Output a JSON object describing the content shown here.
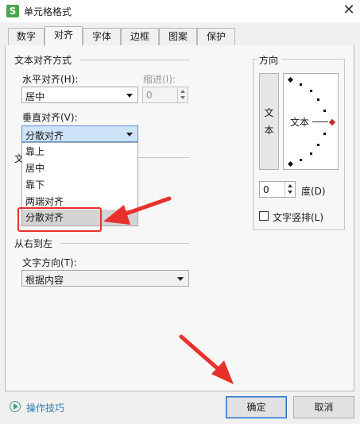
{
  "window": {
    "app_logo": "S",
    "title": "单元格格式",
    "close_glyph": "✕"
  },
  "tabs": [
    {
      "label": "数字",
      "active": false
    },
    {
      "label": "对齐",
      "active": true
    },
    {
      "label": "字体",
      "active": false
    },
    {
      "label": "边框",
      "active": false
    },
    {
      "label": "图案",
      "active": false
    },
    {
      "label": "保护",
      "active": false
    }
  ],
  "text_align": {
    "group_title": "文本对齐方式",
    "horizontal_label": "水平对齐(H):",
    "horizontal_value": "居中",
    "indent_label": "缩进(I):",
    "indent_value": "0",
    "vertical_label": "垂直对齐(V):",
    "vertical_value": "分散对齐",
    "vertical_options": [
      "靠上",
      "居中",
      "靠下",
      "两端对齐",
      "分散对齐"
    ],
    "vertical_selected_index": 4,
    "hidden_group_fragment": "文"
  },
  "rtl": {
    "group_title": "从右到左",
    "direction_label": "文字方向(T):",
    "direction_value": "根据内容"
  },
  "orientation": {
    "group_title": "方向",
    "vertical_text_chars": [
      "文",
      "本"
    ],
    "dial_text": "文本",
    "degree_value": "0",
    "degree_label": "度(D)",
    "vertical_checkbox_label": "文字竖排(L)",
    "vertical_checked": false
  },
  "footer": {
    "help_label": "操作技巧",
    "ok_label": "确定",
    "cancel_label": "取消"
  },
  "colors": {
    "highlight_red": "#e8312c",
    "link_blue": "#2e7db8",
    "focus_blue": "#cfe3f8"
  }
}
